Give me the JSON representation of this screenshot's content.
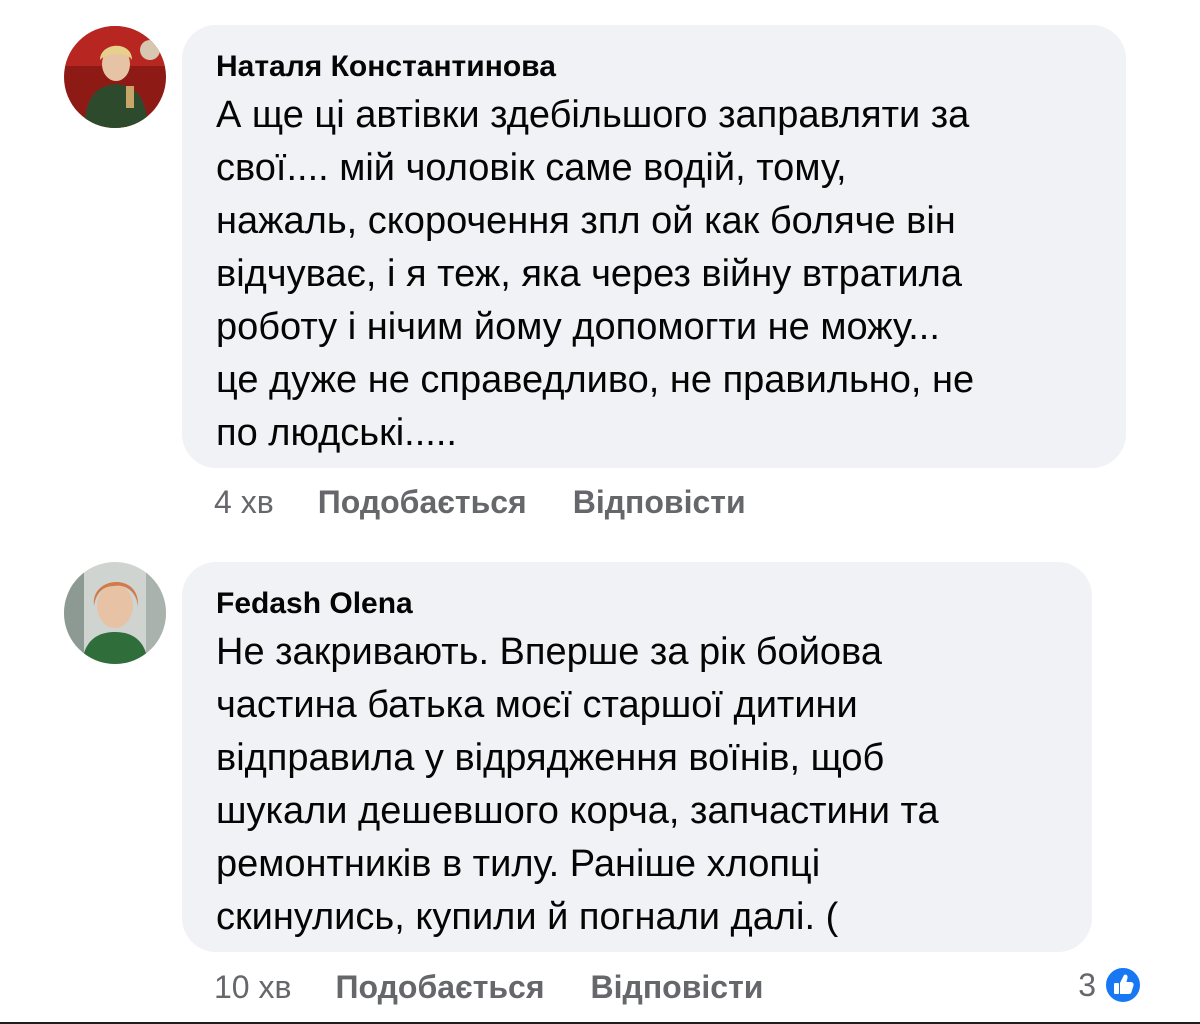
{
  "comments": [
    {
      "author": "Наталя Константинова",
      "text_lines": [
        "А ще ці автівки здебільшого заправляти за",
        "свої.... мій чоловік саме водій, тому,",
        "нажаль, скорочення зпл ой как боляче він",
        "відчуває, і я теж, яка через війну втратила",
        "роботу і нічим йому допомогти не можу...",
        "це дуже не справедливо, не правильно, не",
        "по людські....."
      ],
      "time": "4 хв",
      "like_label": "Подобається",
      "reply_label": "Відповісти"
    },
    {
      "author": "Fedash Olena",
      "text_lines": [
        "Не закривають. Вперше за рік бойова",
        "частина батька моєї старшої дитини",
        "відправила у відрядження воїнів, щоб",
        "шукали дешевшого корча, запчастини та",
        "ремонтників в тилу. Раніше хлопці",
        "скинулись, купили й погнали далі. ("
      ],
      "time": "10 хв",
      "like_label": "Подобається",
      "reply_label": "Відповісти",
      "reaction_count": "3",
      "reaction_icon": "like-badge-icon"
    }
  ],
  "colors": {
    "bubble_bg": "#f0f2f5",
    "secondary_text": "#65676b",
    "like_blue": "#1877f2"
  }
}
